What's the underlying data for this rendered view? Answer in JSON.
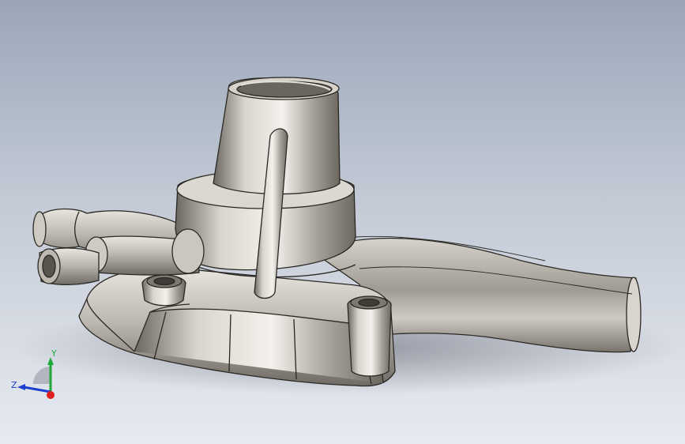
{
  "viewport": {
    "background_top": "#9aa6b8",
    "background_bottom": "#e7eaf0",
    "part_color": "#b9b4ac",
    "edge_color": "#2a2824"
  },
  "triad": {
    "x_label": "",
    "y_label": "Y",
    "z_label": "Z",
    "x_color": "#e02020",
    "y_color": "#1fa83a",
    "z_color": "#1d3fcf"
  }
}
